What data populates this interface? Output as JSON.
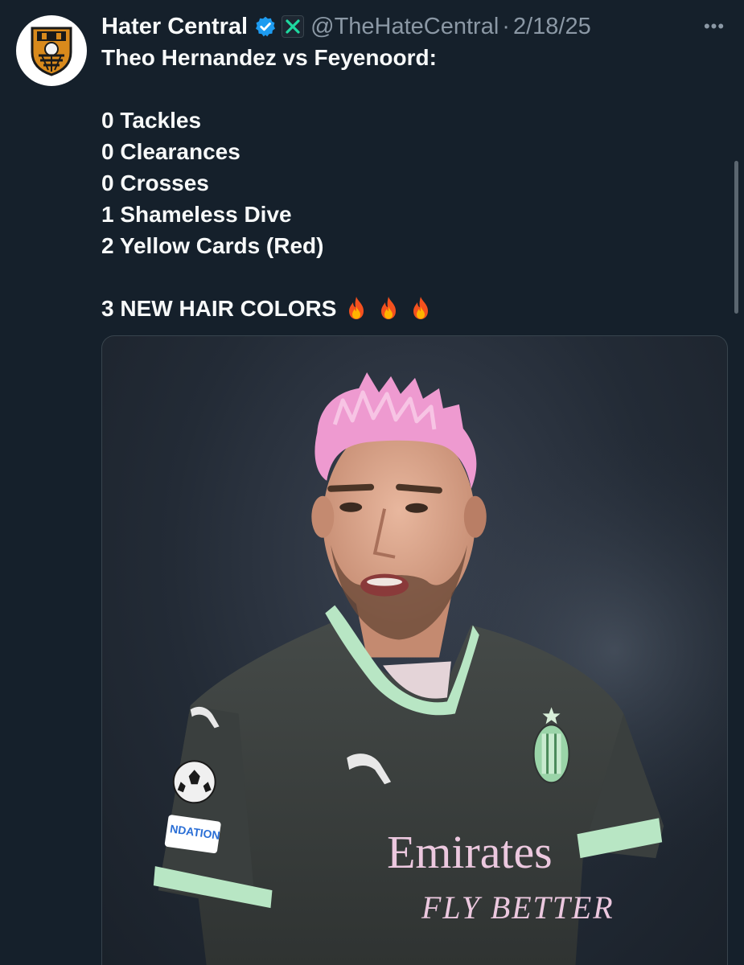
{
  "tweet": {
    "author_name": "Hater Central",
    "handle": "@TheHateCentral",
    "separator": "·",
    "date": "2/18/25",
    "more_label": "•••",
    "lines": [
      "Theo Hernandez vs Feyenoord:",
      "",
      "0 Tackles",
      "0 Clearances",
      "0 Crosses",
      "1 Shameless Dive",
      "2 Yellow Cards (Red)",
      "",
      "3 NEW HAIR COLORS"
    ],
    "emoji_icon": "fire-icon",
    "emoji_count": 3
  },
  "media": {
    "shirt_sponsor_line1": "Emirates",
    "shirt_sponsor_line2": "FLY BETTER",
    "sleeve_patch": "NDATION"
  },
  "colors": {
    "background": "#15202b",
    "text": "#f7f9f9",
    "muted": "#8b98a5",
    "verified": "#1d9bf0",
    "hair": "#ee9ad0",
    "shirt": "#3b403f",
    "trim": "#b8e6c4"
  }
}
